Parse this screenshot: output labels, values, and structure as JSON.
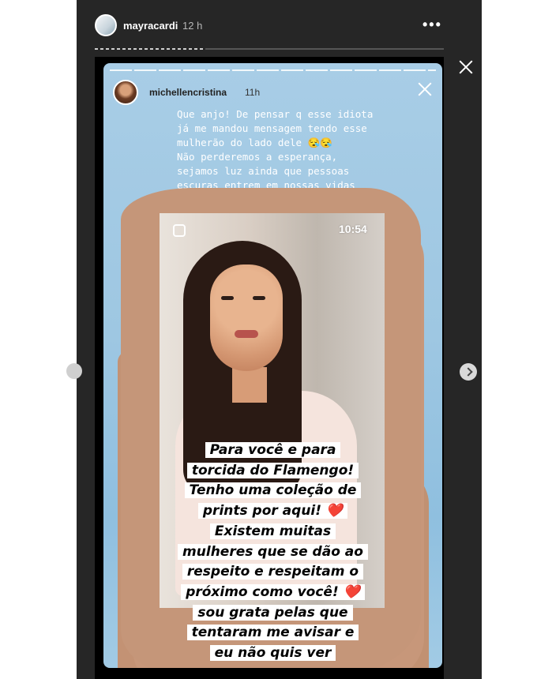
{
  "header": {
    "username": "mayracardi",
    "time": "12 h",
    "more": "•••"
  },
  "story": {
    "username": "michellencristina",
    "time": "11h",
    "caption": "Que anjo! De pensar q esse idiota\njá me mandou mensagem tendo esse\nmulherão do lado dele 😪😪\nNão perderemos a esperança,\nsejamos luz ainda que pessoas\nescuras entrem em nossas vidas\ncomo acontecem muitas vezes ✨🙏🙏",
    "clock": "10:54",
    "overlay_lines": [
      "Para você e para",
      "torcida do Flamengo!",
      "Tenho uma coleção de",
      "prints por aqui! ❤️",
      "Existem muitas",
      "mulheres que se dão ao",
      "respeito e respeitam o",
      "próximo como você! ❤️",
      "sou grata pelas que",
      "tentaram me avisar e",
      "eu não quis ver"
    ]
  }
}
